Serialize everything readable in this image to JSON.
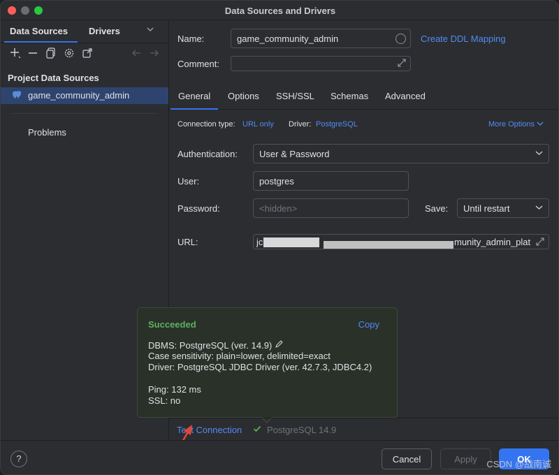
{
  "window": {
    "title": "Data Sources and Drivers"
  },
  "left": {
    "tabs": [
      {
        "label": "Data Sources"
      },
      {
        "label": "Drivers"
      }
    ],
    "section_title": "Project Data Sources",
    "datasource": {
      "label": "game_community_admin",
      "icon": "postgresql-elephant-icon"
    },
    "problems": "Problems"
  },
  "form": {
    "name_label": "Name:",
    "name_value": "game_community_admin",
    "ddl_link": "Create DDL Mapping",
    "comment_label": "Comment:",
    "comment_value": ""
  },
  "tabs": [
    {
      "label": "General"
    },
    {
      "label": "Options"
    },
    {
      "label": "SSH/SSL"
    },
    {
      "label": "Schemas"
    },
    {
      "label": "Advanced"
    }
  ],
  "general": {
    "conn_type_label": "Connection type:",
    "conn_type_value": "URL only",
    "driver_label": "Driver:",
    "driver_value": "PostgreSQL",
    "more_options": "More Options",
    "auth_label": "Authentication:",
    "auth_value": "User & Password",
    "user_label": "User:",
    "user_value": "postgres",
    "password_label": "Password:",
    "password_placeholder": "<hidden>",
    "save_label": "Save:",
    "save_value": "Until restart",
    "url_label": "URL:",
    "url_prefix": "jc",
    "url_suffix": "munity_admin_plat"
  },
  "popup": {
    "status": "Succeeded",
    "copy": "Copy",
    "dbms": "DBMS: PostgreSQL (ver. 14.9)",
    "case": "Case sensitivity: plain=lower, delimited=exact",
    "driver": "Driver: PostgreSQL JDBC Driver (ver. 42.7.3, JDBC4.2)",
    "ping": "Ping: 132 ms",
    "ssl": "SSL: no"
  },
  "test": {
    "link": "Test Connection",
    "version": "PostgreSQL 14.9"
  },
  "buttons": {
    "help": "?",
    "cancel": "Cancel",
    "apply": "Apply",
    "ok": "OK"
  },
  "watermark": "CSDN @战南诚",
  "colors": {
    "accent": "#3574f0",
    "link": "#548af7",
    "success": "#5fb05f",
    "selection": "#2e436e",
    "annotation_arrow": "#e5443a"
  }
}
